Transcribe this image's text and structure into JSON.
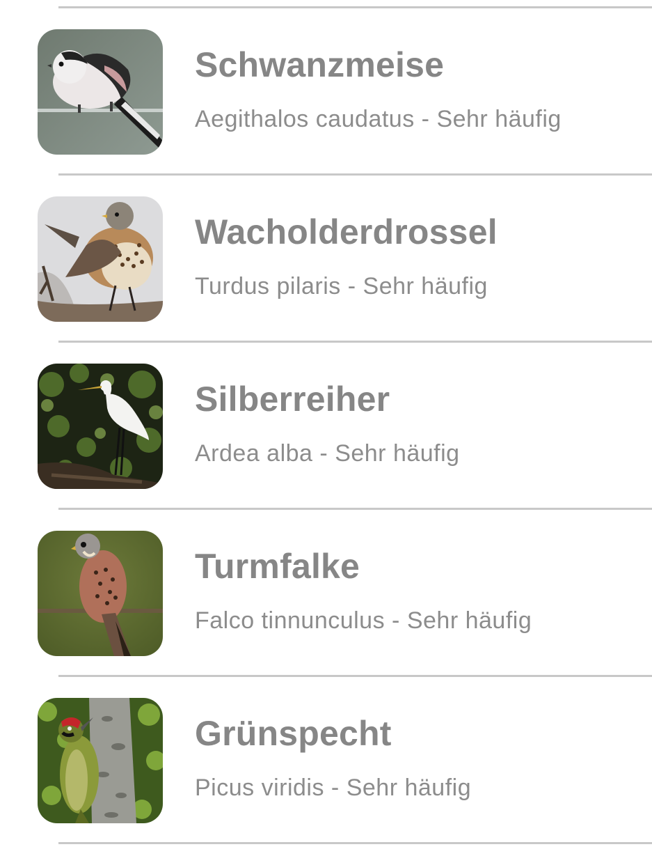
{
  "birds": [
    {
      "name": "Schwanzmeise",
      "latin": "Aegithalos caudatus",
      "frequency": "Sehr häufig",
      "image_icon": "long-tailed-tit-photo"
    },
    {
      "name": "Wacholderdrossel",
      "latin": "Turdus pilaris",
      "frequency": "Sehr häufig",
      "image_icon": "fieldfare-photo"
    },
    {
      "name": "Silberreiher",
      "latin": "Ardea alba",
      "frequency": "Sehr häufig",
      "image_icon": "great-egret-photo"
    },
    {
      "name": "Turmfalke",
      "latin": "Falco tinnunculus",
      "frequency": "Sehr häufig",
      "image_icon": "kestrel-photo"
    },
    {
      "name": "Grünspecht",
      "latin": "Picus viridis",
      "frequency": "Sehr häufig",
      "image_icon": "green-woodpecker-photo"
    }
  ],
  "separator": " - ",
  "colors": {
    "title": "#868686",
    "subtitle": "#8c8c8c",
    "divider": "#c8c8c8"
  }
}
